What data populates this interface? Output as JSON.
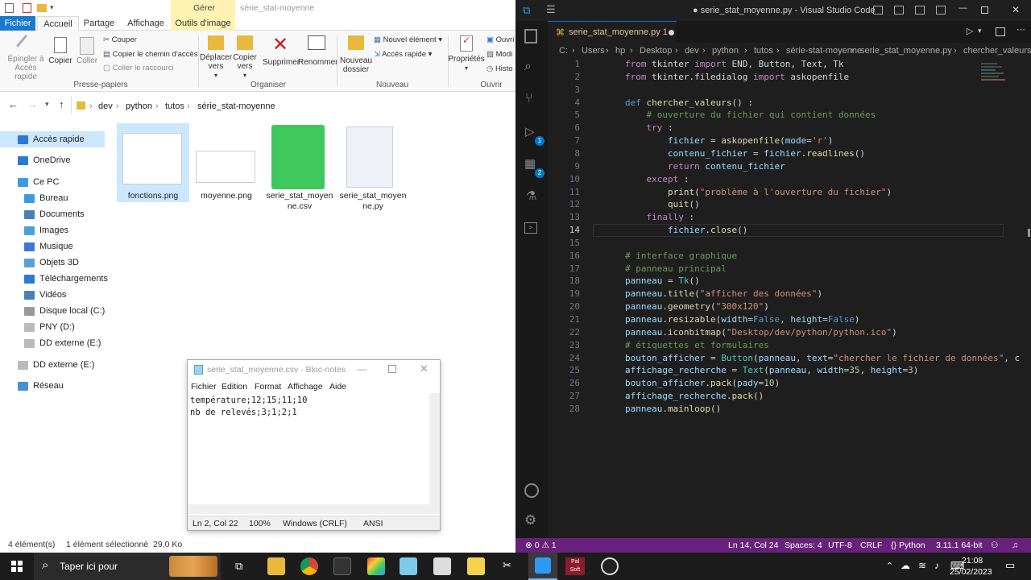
{
  "explorer": {
    "qat_ctx_tab": "Gérer",
    "qat_title": "série_stat-moyenne",
    "tabs": [
      "Fichier",
      "Accueil",
      "Partage",
      "Affichage",
      "Outils d'image"
    ],
    "ribbon": {
      "pin": "Épingler à Accès rapide",
      "copy": "Copier",
      "paste": "Coller",
      "cut": "Couper",
      "copy_path": "Copier le chemin d'accès",
      "paste_shortcut": "Coller le raccourci",
      "move_to": "Déplacer vers",
      "copy_to": "Copier vers",
      "delete": "Supprimer",
      "rename": "Renommer",
      "new_folder": "Nouveau dossier",
      "new_item": "Nouvel élément",
      "easy_access": "Accès rapide",
      "properties": "Propriétés",
      "open": "Ouvri",
      "edit": "Modi",
      "history": "Histo",
      "groups": [
        "Presse-papiers",
        "Organiser",
        "Nouveau",
        "Ouvrir"
      ]
    },
    "breadcrumb": [
      "dev",
      "python",
      "tutos",
      "série_stat-moyenne"
    ],
    "nav": [
      "Accès rapide",
      "OneDrive",
      "Ce PC",
      "Bureau",
      "Documents",
      "Images",
      "Musique",
      "Objets 3D",
      "Téléchargements",
      "Vidéos",
      "Disque local (C:)",
      "PNY (D:)",
      "DD externe (E:)",
      "DD externe (E:)",
      "Réseau"
    ],
    "files": [
      {
        "name": "fonctions.png"
      },
      {
        "name": "moyenne.png"
      },
      {
        "name": "serie_stat_moyenne.csv",
        "line1": "serie_stat_moyen",
        "line2": "ne.csv"
      },
      {
        "name": "serie_stat_moyenne.py",
        "line1": "serie_stat_moyen",
        "line2": "ne.py"
      }
    ],
    "status": {
      "count": "4 élément(s)",
      "selected": "1 élément sélectionné  29,0 Ko"
    }
  },
  "notepad": {
    "title": "serie_stat_moyenne.csv - Bloc-notes",
    "menu": [
      "Fichier",
      "Edition",
      "Format",
      "Affichage",
      "Aide"
    ],
    "lines": [
      "température;12;15;11;10",
      "nb de relevés;3;1;2;1"
    ],
    "status": {
      "pos": "Ln 2, Col 22",
      "zoom": "100%",
      "eol": "Windows (CRLF)",
      "enc": "ANSI"
    }
  },
  "vscode": {
    "title": "● serie_stat_moyenne.py - Visual Studio Code",
    "tab": "serie_stat_moyenne.py 1",
    "breadcrumb": [
      "C:",
      "Users",
      "hp",
      "Desktop",
      "dev",
      "python",
      "tutos",
      "série-stat-moyenne",
      "serie_stat_moyenne.py",
      "chercher_valeurs"
    ],
    "badges": {
      "scm": "1",
      "ext": "2"
    },
    "status": {
      "errors": "⊗ 0 ⚠ 1",
      "pos": "Ln 14, Col 24",
      "spaces": "Spaces: 4",
      "enc": "UTF-8",
      "eol": "CRLF",
      "lang": "Python",
      "ver": "3.11.1 64-bit"
    }
  },
  "taskbar": {
    "search": "Taper ici pour",
    "time": "21:08",
    "date": "25/02/2023",
    "app_badge": "Pal Soft"
  },
  "colors": {
    "accent": "#0063b1",
    "vs_status": "#68217a",
    "vs_bg": "#1e1e1e",
    "taskbar": "#1c1c1c"
  }
}
